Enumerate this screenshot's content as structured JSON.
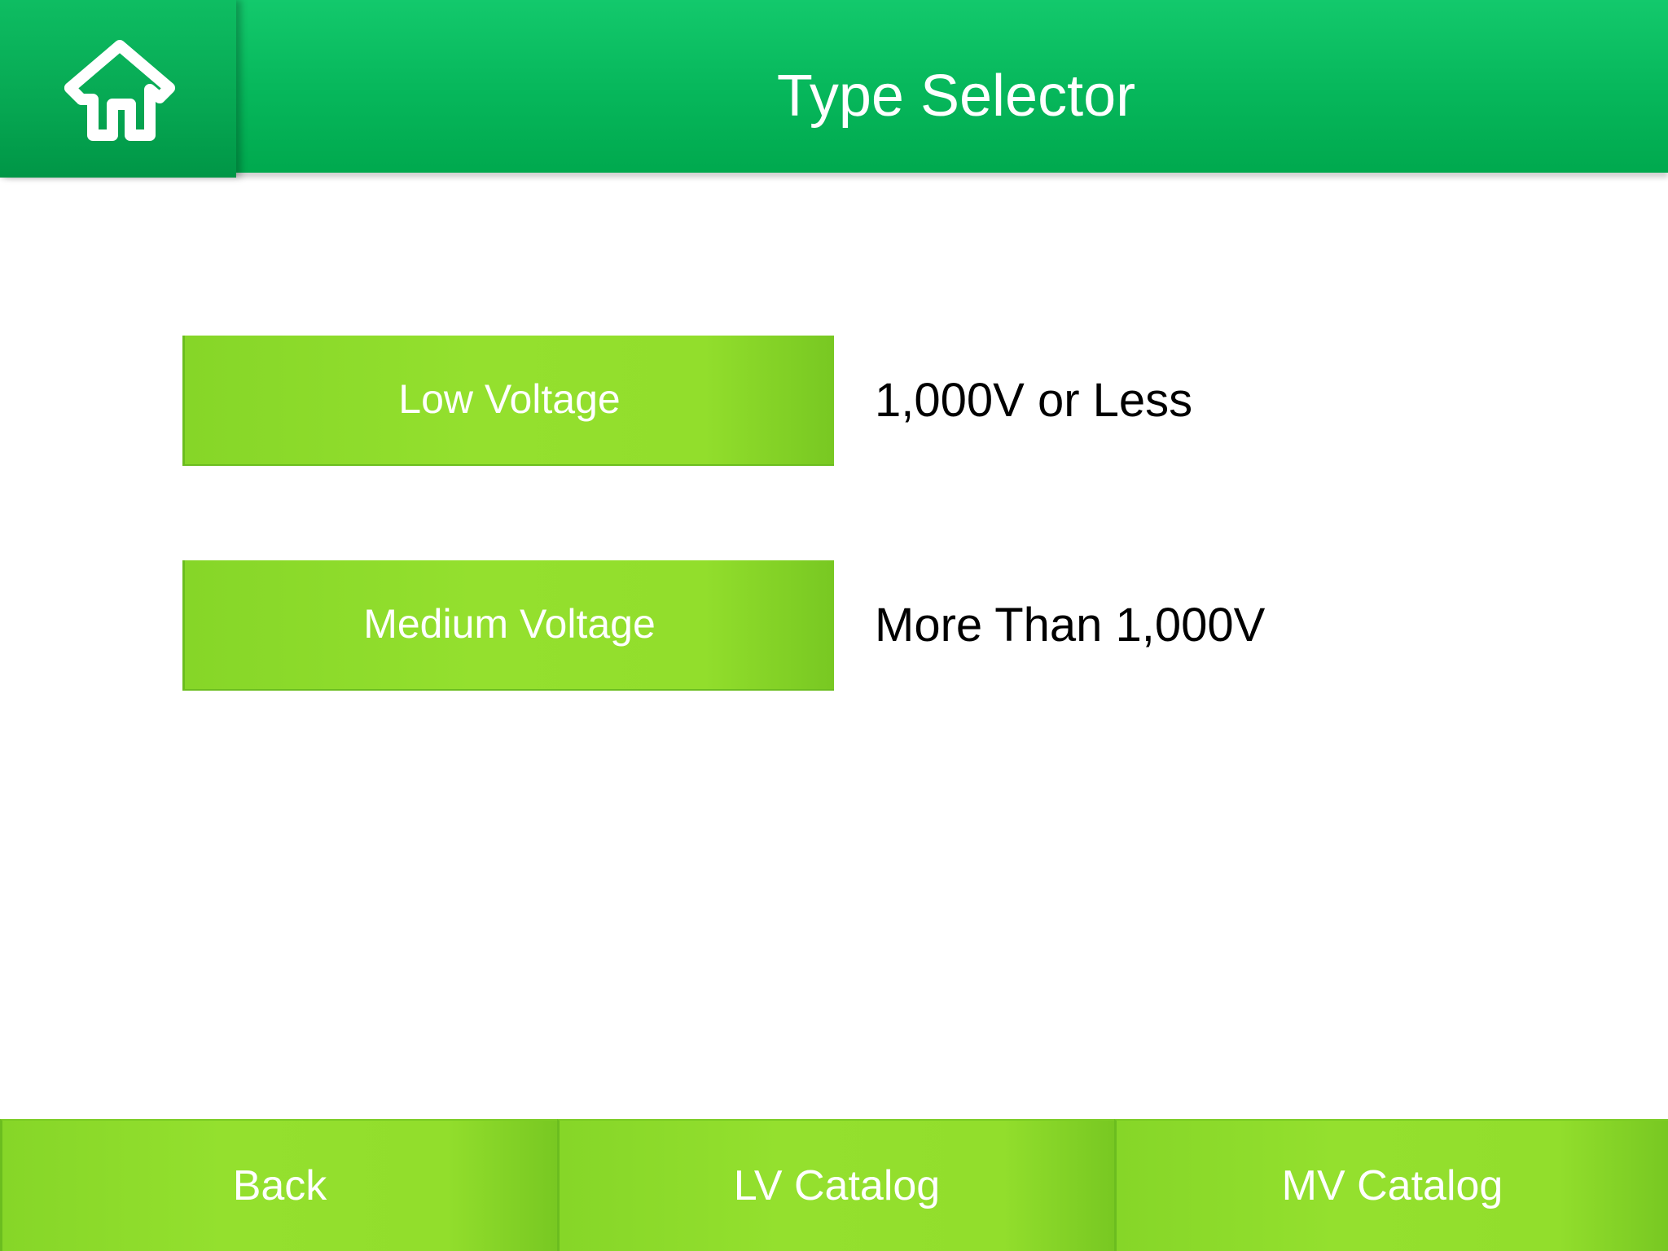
{
  "header": {
    "title": "Type Selector",
    "home_icon": "home-icon"
  },
  "options": [
    {
      "label": "Low Voltage",
      "description": "1,000V or Less"
    },
    {
      "label": "Medium Voltage",
      "description": "More Than 1,000V"
    }
  ],
  "bottom_nav": {
    "back_label": "Back",
    "lv_catalog_label": "LV Catalog",
    "mv_catalog_label": "MV Catalog"
  },
  "colors": {
    "header_green": "#07b85c",
    "button_green": "#92de2c",
    "text_white": "#ffffff"
  }
}
